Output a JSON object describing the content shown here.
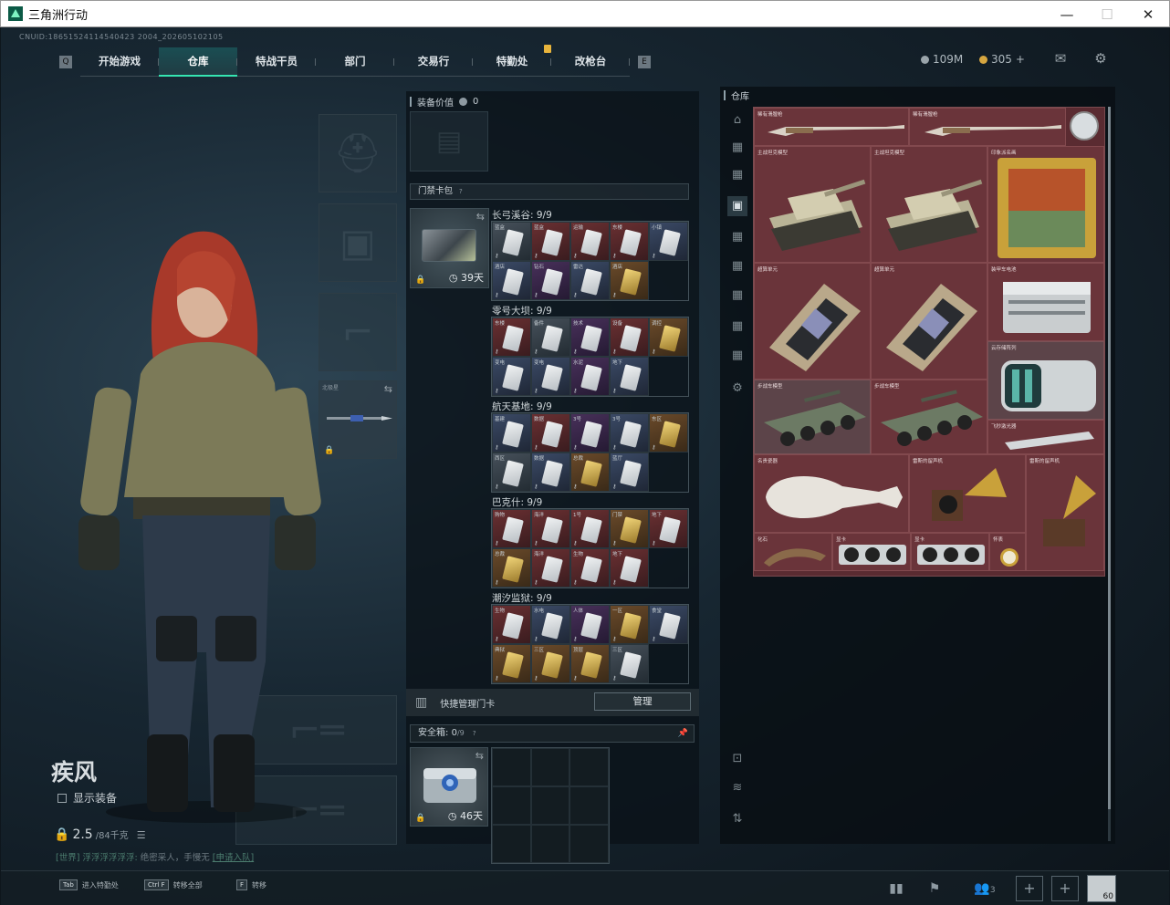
{
  "window": {
    "title": "三角洲行动",
    "min": "—",
    "max": "☐",
    "close": "✕"
  },
  "cnuid": "CNUID:18651524114540423 2004_202605102105",
  "nav": {
    "left_key": "Q",
    "right_key": "E",
    "tabs": [
      "开始游戏",
      "仓库",
      "特战干员",
      "部门",
      "交易行",
      "特勤处",
      "改枪台"
    ],
    "active_tab": "仓库"
  },
  "currency": {
    "silver": "109M",
    "gold": "305",
    "gold_plus": "+"
  },
  "colors": {
    "accent": "#35e5b1",
    "stash_bg": "#5a2b31",
    "chat_green": "#4c7d6f"
  },
  "equipment": {
    "melee_label": "北极星",
    "slot1": "1",
    "slot2": "2"
  },
  "character": {
    "name": "疾风",
    "show_equipment": "显示装备",
    "weight_value": "2.5",
    "weight_max": "/84千克"
  },
  "chat": {
    "channel": "[世界]",
    "sender": "浮浮浮浮浮浮:",
    "text": "绝密采人，手慢无",
    "link": "[申请入队]"
  },
  "equip_value": {
    "label": "装备价值",
    "value": "0"
  },
  "keycard_pack": {
    "label": "门禁卡包",
    "help": "?",
    "days": "39天"
  },
  "regions": [
    {
      "name": "长弓溪谷: 9/9",
      "cards": [
        [
          "g",
          "蓝盒"
        ],
        [
          "r",
          "蓝盒"
        ],
        [
          "r",
          "运输"
        ],
        [
          "r",
          "东楼"
        ],
        [
          "b",
          "小镇"
        ],
        [
          "b",
          "酒店"
        ],
        [
          "p",
          "钻石"
        ],
        [
          "b",
          "雷达"
        ],
        [
          "o",
          "酒店"
        ]
      ]
    },
    {
      "name": "零号大坝: 9/9",
      "cards": [
        [
          "r",
          "东楼"
        ],
        [
          "g",
          "备件"
        ],
        [
          "p",
          "技术"
        ],
        [
          "r",
          "设备"
        ],
        [
          "o",
          "调控"
        ],
        [
          "b",
          "变电"
        ],
        [
          "b",
          "变电"
        ],
        [
          "p",
          "水泥"
        ],
        [
          "b",
          "地下"
        ]
      ]
    },
    {
      "name": "航天基地: 9/9",
      "cards": [
        [
          "b",
          "基建"
        ],
        [
          "r",
          "数据"
        ],
        [
          "p",
          "3号"
        ],
        [
          "b",
          "3号"
        ],
        [
          "o",
          "东区"
        ],
        [
          "g",
          "西区"
        ],
        [
          "b",
          "数据"
        ],
        [
          "o",
          "总裁"
        ],
        [
          "b",
          "蓝厅"
        ]
      ]
    },
    {
      "name": "巴克什: 9/9",
      "cards": [
        [
          "r",
          "购物"
        ],
        [
          "r",
          "海洋"
        ],
        [
          "r",
          "1号"
        ],
        [
          "o",
          "门禁"
        ],
        [
          "r",
          "地下"
        ],
        [
          "o",
          "总裁"
        ],
        [
          "r",
          "海洋"
        ],
        [
          "r",
          "生物"
        ],
        [
          "r",
          "地下"
        ]
      ]
    },
    {
      "name": "潮汐监狱: 9/9",
      "cards": [
        [
          "r",
          "生物"
        ],
        [
          "b",
          "水电"
        ],
        [
          "p",
          "人体"
        ],
        [
          "o",
          "一区"
        ],
        [
          "b",
          "食堂"
        ],
        [
          "o",
          "典狱"
        ],
        [
          "o",
          "三区"
        ],
        [
          "o",
          "顶层"
        ],
        [
          "g",
          "三区"
        ]
      ]
    }
  ],
  "quick_manage": {
    "label": "快捷管理门卡",
    "button": "管理"
  },
  "safe_box": {
    "label": "安全箱:",
    "count": "0",
    "capacity": "/9",
    "help": "?",
    "days": "46天"
  },
  "stash": {
    "title": "仓库",
    "items": {
      "rifle1": "稀有滑膛枪",
      "rifle2": "稀有滑膛枪",
      "tank1": "主战坦克模型",
      "tank2": "主战坦克模型",
      "painting": "印象派名画",
      "chip1": "超算单元",
      "chip2": "超算单元",
      "ammo": "装甲车电池",
      "server": "云存储阵列",
      "apc1": "步战车模型",
      "apc2": "步战车模型",
      "laser": "飞秒激光器",
      "vase": "名贵瓷器",
      "gramophone1": "雷斯的留声机",
      "gramophone2": "雷斯的留声机",
      "fossil": "化石",
      "gpu1": "显卡",
      "gpu2": "显卡",
      "watch": "怀表"
    }
  },
  "bottom": {
    "hints": [
      [
        "Tab",
        "进入特勤处"
      ],
      [
        "Ctrl F",
        "转移全部"
      ],
      [
        "F",
        "转移"
      ]
    ],
    "team_count": "3",
    "level": "60"
  }
}
